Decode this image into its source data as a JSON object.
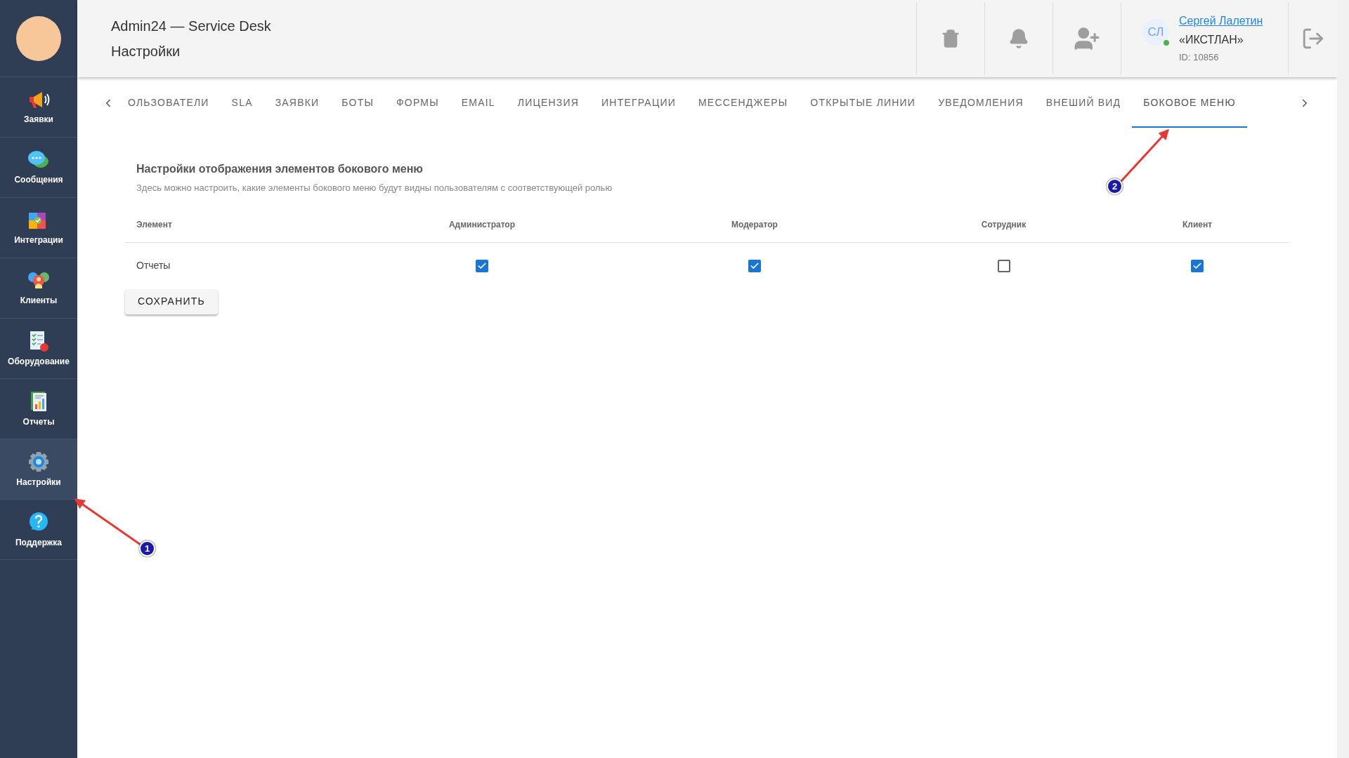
{
  "sidebar": {
    "items": [
      {
        "label": "Заявки",
        "kind": "megaphone",
        "selected": false
      },
      {
        "label": "Сообщения",
        "kind": "chat",
        "selected": false
      },
      {
        "label": "Интеграции",
        "kind": "puzzle",
        "selected": false
      },
      {
        "label": "Клиенты",
        "kind": "people",
        "selected": false
      },
      {
        "label": "Оборудование",
        "kind": "checklist",
        "selected": false
      },
      {
        "label": "Отчеты",
        "kind": "report",
        "selected": false
      },
      {
        "label": "Настройки",
        "kind": "gear",
        "selected": true
      },
      {
        "label": "Поддержка",
        "kind": "help",
        "selected": false
      }
    ]
  },
  "header": {
    "app_title": "Admin24 — Service Desk",
    "page_title": "Настройки",
    "actions": [
      {
        "kind": "trash"
      },
      {
        "kind": "bell"
      },
      {
        "kind": "add-user"
      }
    ],
    "user": {
      "initials": "СЛ",
      "online": true,
      "name": "Сергей Лалетин",
      "company": "«ИКСТЛАН»",
      "id": "ID: 10856"
    }
  },
  "tabs": [
    {
      "label": "ОЛЬЗОВАТЕЛИ",
      "selected": false
    },
    {
      "label": "SLA",
      "selected": false
    },
    {
      "label": "ЗАЯВКИ",
      "selected": false
    },
    {
      "label": "БОТЫ",
      "selected": false
    },
    {
      "label": "ФОРМЫ",
      "selected": false
    },
    {
      "label": "EMAIL",
      "selected": false
    },
    {
      "label": "ЛИЦЕНЗИЯ",
      "selected": false
    },
    {
      "label": "ИНТЕГРАЦИИ",
      "selected": false
    },
    {
      "label": "МЕССЕНДЖЕРЫ",
      "selected": false
    },
    {
      "label": "ОТКРЫТЫЕ ЛИНИИ",
      "selected": false
    },
    {
      "label": "УВЕДОМЛЕНИЯ",
      "selected": false
    },
    {
      "label": "ВНЕШИЙ ВИД",
      "selected": false
    },
    {
      "label": "БОКОВОЕ МЕНЮ",
      "selected": true
    }
  ],
  "section": {
    "title": "Настройки отображения элементов бокового меню",
    "description": "Здесь можно настроить, какие элементы бокового меню будут видны пользователям с соответствующей ролью"
  },
  "table": {
    "columns": [
      "Элемент",
      "Администратор",
      "Модератор",
      "Сотрудник",
      "Клиент"
    ],
    "rows": [
      {
        "element": "Отчеты",
        "checks": [
          {
            "checked": true
          },
          {
            "checked": true
          },
          {
            "checked": false
          },
          {
            "checked": true
          }
        ]
      }
    ]
  },
  "save_button": "СОХРАНИТЬ",
  "annotations": [
    {
      "label": "1",
      "kind": "sidebar"
    },
    {
      "label": "2",
      "kind": "tab"
    }
  ]
}
